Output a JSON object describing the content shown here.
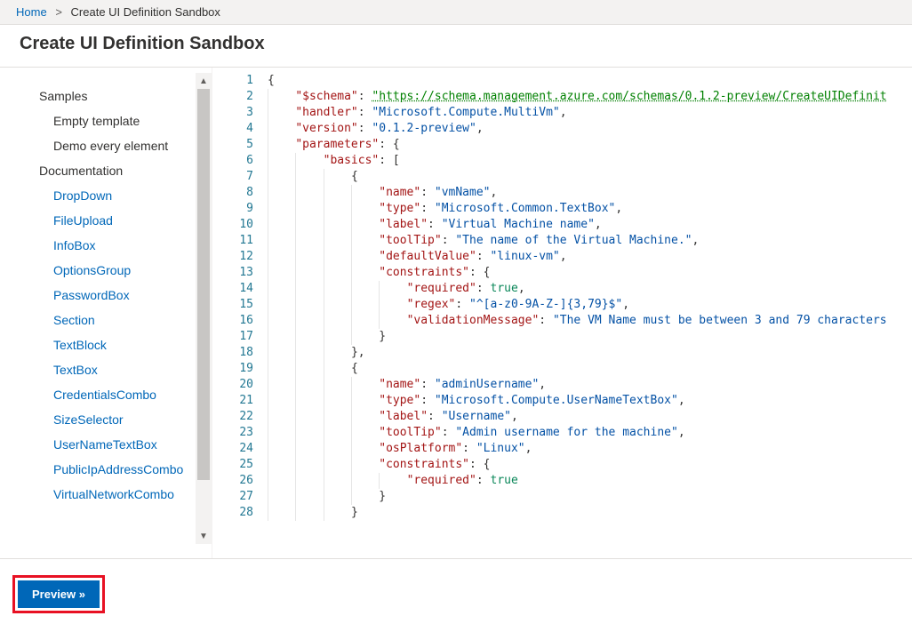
{
  "breadcrumb": {
    "home": "Home",
    "current": "Create UI Definition Sandbox"
  },
  "page_title": "Create UI Definition Sandbox",
  "sidebar": {
    "groups": [
      {
        "label": "Samples",
        "items": [
          {
            "label": "Empty template",
            "link": false
          },
          {
            "label": "Demo every element",
            "link": false
          }
        ]
      },
      {
        "label": "Documentation",
        "items": [
          {
            "label": "DropDown",
            "link": true
          },
          {
            "label": "FileUpload",
            "link": true
          },
          {
            "label": "InfoBox",
            "link": true
          },
          {
            "label": "OptionsGroup",
            "link": true
          },
          {
            "label": "PasswordBox",
            "link": true
          },
          {
            "label": "Section",
            "link": true
          },
          {
            "label": "TextBlock",
            "link": true
          },
          {
            "label": "TextBox",
            "link": true
          },
          {
            "label": "CredentialsCombo",
            "link": true
          },
          {
            "label": "SizeSelector",
            "link": true
          },
          {
            "label": "UserNameTextBox",
            "link": true
          },
          {
            "label": "PublicIpAddressCombo",
            "link": true
          },
          {
            "label": "VirtualNetworkCombo",
            "link": true
          }
        ]
      }
    ]
  },
  "editor": {
    "first_line": 1,
    "last_line": 28,
    "json_content": {
      "$schema": "https://schema.management.azure.com/schemas/0.1.2-preview/CreateUIDefinit",
      "handler": "Microsoft.Compute.MultiVm",
      "version": "0.1.2-preview",
      "parameters": {
        "basics": [
          {
            "name": "vmName",
            "type": "Microsoft.Common.TextBox",
            "label": "Virtual Machine name",
            "toolTip": "The name of the Virtual Machine.",
            "defaultValue": "linux-vm",
            "constraints": {
              "required": true,
              "regex": "^[a-z0-9A-Z-]{3,79}$",
              "validationMessage": "The VM Name must be between 3 and 79 characters"
            }
          },
          {
            "name": "adminUsername",
            "type": "Microsoft.Compute.UserNameTextBox",
            "label": "Username",
            "toolTip": "Admin username for the machine",
            "osPlatform": "Linux",
            "constraints": {
              "required": true
            }
          }
        ]
      }
    },
    "lines": [
      [
        {
          "t": "brace",
          "v": "{"
        }
      ],
      [
        {
          "t": "ind",
          "v": 1
        },
        {
          "t": "key",
          "v": "\"$schema\""
        },
        {
          "t": "punc",
          "v": ": "
        },
        {
          "t": "url",
          "v": "\"https://schema.management.azure.com/schemas/0.1.2-preview/CreateUIDefinit"
        }
      ],
      [
        {
          "t": "ind",
          "v": 1
        },
        {
          "t": "key",
          "v": "\"handler\""
        },
        {
          "t": "punc",
          "v": ": "
        },
        {
          "t": "str",
          "v": "\"Microsoft.Compute.MultiVm\""
        },
        {
          "t": "punc",
          "v": ","
        }
      ],
      [
        {
          "t": "ind",
          "v": 1
        },
        {
          "t": "key",
          "v": "\"version\""
        },
        {
          "t": "punc",
          "v": ": "
        },
        {
          "t": "str",
          "v": "\"0.1.2-preview\""
        },
        {
          "t": "punc",
          "v": ","
        }
      ],
      [
        {
          "t": "ind",
          "v": 1
        },
        {
          "t": "key",
          "v": "\"parameters\""
        },
        {
          "t": "punc",
          "v": ": "
        },
        {
          "t": "brace",
          "v": "{"
        }
      ],
      [
        {
          "t": "ind",
          "v": 2
        },
        {
          "t": "key",
          "v": "\"basics\""
        },
        {
          "t": "punc",
          "v": ": ["
        }
      ],
      [
        {
          "t": "ind",
          "v": 3
        },
        {
          "t": "brace",
          "v": "{"
        }
      ],
      [
        {
          "t": "ind",
          "v": 4
        },
        {
          "t": "key",
          "v": "\"name\""
        },
        {
          "t": "punc",
          "v": ": "
        },
        {
          "t": "str",
          "v": "\"vmName\""
        },
        {
          "t": "punc",
          "v": ","
        }
      ],
      [
        {
          "t": "ind",
          "v": 4
        },
        {
          "t": "key",
          "v": "\"type\""
        },
        {
          "t": "punc",
          "v": ": "
        },
        {
          "t": "str",
          "v": "\"Microsoft.Common.TextBox\""
        },
        {
          "t": "punc",
          "v": ","
        }
      ],
      [
        {
          "t": "ind",
          "v": 4
        },
        {
          "t": "key",
          "v": "\"label\""
        },
        {
          "t": "punc",
          "v": ": "
        },
        {
          "t": "str",
          "v": "\"Virtual Machine name\""
        },
        {
          "t": "punc",
          "v": ","
        }
      ],
      [
        {
          "t": "ind",
          "v": 4
        },
        {
          "t": "key",
          "v": "\"toolTip\""
        },
        {
          "t": "punc",
          "v": ": "
        },
        {
          "t": "str",
          "v": "\"The name of the Virtual Machine.\""
        },
        {
          "t": "punc",
          "v": ","
        }
      ],
      [
        {
          "t": "ind",
          "v": 4
        },
        {
          "t": "key",
          "v": "\"defaultValue\""
        },
        {
          "t": "punc",
          "v": ": "
        },
        {
          "t": "str",
          "v": "\"linux-vm\""
        },
        {
          "t": "punc",
          "v": ","
        }
      ],
      [
        {
          "t": "ind",
          "v": 4
        },
        {
          "t": "key",
          "v": "\"constraints\""
        },
        {
          "t": "punc",
          "v": ": "
        },
        {
          "t": "brace",
          "v": "{"
        }
      ],
      [
        {
          "t": "ind",
          "v": 5
        },
        {
          "t": "key",
          "v": "\"required\""
        },
        {
          "t": "punc",
          "v": ": "
        },
        {
          "t": "bool",
          "v": "true"
        },
        {
          "t": "punc",
          "v": ","
        }
      ],
      [
        {
          "t": "ind",
          "v": 5
        },
        {
          "t": "key",
          "v": "\"regex\""
        },
        {
          "t": "punc",
          "v": ": "
        },
        {
          "t": "str",
          "v": "\"^[a-z0-9A-Z-]{3,79}$\""
        },
        {
          "t": "punc",
          "v": ","
        }
      ],
      [
        {
          "t": "ind",
          "v": 5
        },
        {
          "t": "key",
          "v": "\"validationMessage\""
        },
        {
          "t": "punc",
          "v": ": "
        },
        {
          "t": "str",
          "v": "\"The VM Name must be between 3 and 79 characters"
        }
      ],
      [
        {
          "t": "ind",
          "v": 4
        },
        {
          "t": "brace",
          "v": "}"
        }
      ],
      [
        {
          "t": "ind",
          "v": 3
        },
        {
          "t": "brace",
          "v": "},"
        }
      ],
      [
        {
          "t": "ind",
          "v": 3
        },
        {
          "t": "brace",
          "v": "{"
        }
      ],
      [
        {
          "t": "ind",
          "v": 4
        },
        {
          "t": "key",
          "v": "\"name\""
        },
        {
          "t": "punc",
          "v": ": "
        },
        {
          "t": "str",
          "v": "\"adminUsername\""
        },
        {
          "t": "punc",
          "v": ","
        }
      ],
      [
        {
          "t": "ind",
          "v": 4
        },
        {
          "t": "key",
          "v": "\"type\""
        },
        {
          "t": "punc",
          "v": ": "
        },
        {
          "t": "str",
          "v": "\"Microsoft.Compute.UserNameTextBox\""
        },
        {
          "t": "punc",
          "v": ","
        }
      ],
      [
        {
          "t": "ind",
          "v": 4
        },
        {
          "t": "key",
          "v": "\"label\""
        },
        {
          "t": "punc",
          "v": ": "
        },
        {
          "t": "str",
          "v": "\"Username\""
        },
        {
          "t": "punc",
          "v": ","
        }
      ],
      [
        {
          "t": "ind",
          "v": 4
        },
        {
          "t": "key",
          "v": "\"toolTip\""
        },
        {
          "t": "punc",
          "v": ": "
        },
        {
          "t": "str",
          "v": "\"Admin username for the machine\""
        },
        {
          "t": "punc",
          "v": ","
        }
      ],
      [
        {
          "t": "ind",
          "v": 4
        },
        {
          "t": "key",
          "v": "\"osPlatform\""
        },
        {
          "t": "punc",
          "v": ": "
        },
        {
          "t": "str",
          "v": "\"Linux\""
        },
        {
          "t": "punc",
          "v": ","
        }
      ],
      [
        {
          "t": "ind",
          "v": 4
        },
        {
          "t": "key",
          "v": "\"constraints\""
        },
        {
          "t": "punc",
          "v": ": "
        },
        {
          "t": "brace",
          "v": "{"
        }
      ],
      [
        {
          "t": "ind",
          "v": 5
        },
        {
          "t": "key",
          "v": "\"required\""
        },
        {
          "t": "punc",
          "v": ": "
        },
        {
          "t": "bool",
          "v": "true"
        }
      ],
      [
        {
          "t": "ind",
          "v": 4
        },
        {
          "t": "brace",
          "v": "}"
        }
      ],
      [
        {
          "t": "ind",
          "v": 3
        },
        {
          "t": "brace",
          "v": "}"
        }
      ]
    ]
  },
  "footer": {
    "preview_label": "Preview »"
  },
  "colors": {
    "link": "#0067b8",
    "accent_red": "#e81123"
  }
}
